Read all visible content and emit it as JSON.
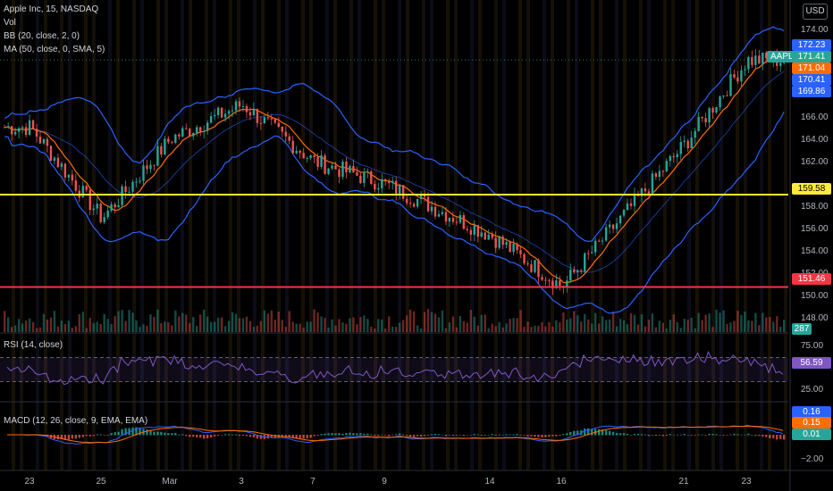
{
  "header": {
    "title": "Apple Inc, 15, NASDAQ",
    "vol": "Vol",
    "bb": "BB (20, close, 2, 0)",
    "ma": "MA (50, close, 0, SMA, 5)",
    "currency": "USD"
  },
  "price_axis": {
    "ticks": [
      "174.00",
      "166.00",
      "164.00",
      "162.00",
      "158.00",
      "156.00",
      "154.00",
      "152.00",
      "150.00",
      "148.00"
    ]
  },
  "rsi_panel": {
    "label": "RSI (14, close)",
    "ticks": [
      "75.00",
      "25.00"
    ],
    "current": "56.59"
  },
  "macd_panel": {
    "label": "MACD (12, 26, close, 9, EMA, EMA)",
    "ticks": [
      "0.16",
      "0.15",
      "0.01",
      "−2.00"
    ]
  },
  "time_axis": [
    "23",
    "25",
    "Mar",
    "3",
    "7",
    "9",
    "14",
    "16",
    "21",
    "23"
  ],
  "price_tags": {
    "bb_upper": "172.23",
    "symbol": "AAPL",
    "last": "171.41",
    "ma": "171.04",
    "bb_mid": "170.41",
    "bb_lower": "169.86",
    "yellow_line": "159.58",
    "red_line": "151.46",
    "volume": "287"
  },
  "colors": {
    "up": "#26a69a",
    "down": "#ef5350",
    "bb": "#2962ff",
    "ma": "#ff6d00",
    "yellow": "#ffeb3b",
    "red": "#f23645",
    "rsi": "#7e57c2",
    "macd": "#2962ff",
    "signal": "#ff6d00"
  },
  "chart_data": {
    "type": "line",
    "title": "Apple Inc, 15, NASDAQ",
    "x": [
      "23",
      "25",
      "Mar",
      "3",
      "7",
      "9",
      "14",
      "16",
      "21",
      "23"
    ],
    "series": [
      {
        "name": "AAPL",
        "values": [
          165.5,
          157.5,
          164.5,
          167.5,
          162.5,
          160.5,
          156.0,
          151.5,
          164.0,
          171.4
        ]
      }
    ],
    "horizontal_lines": [
      159.58,
      151.46
    ],
    "ylim": [
      147.5,
      175.5
    ]
  }
}
